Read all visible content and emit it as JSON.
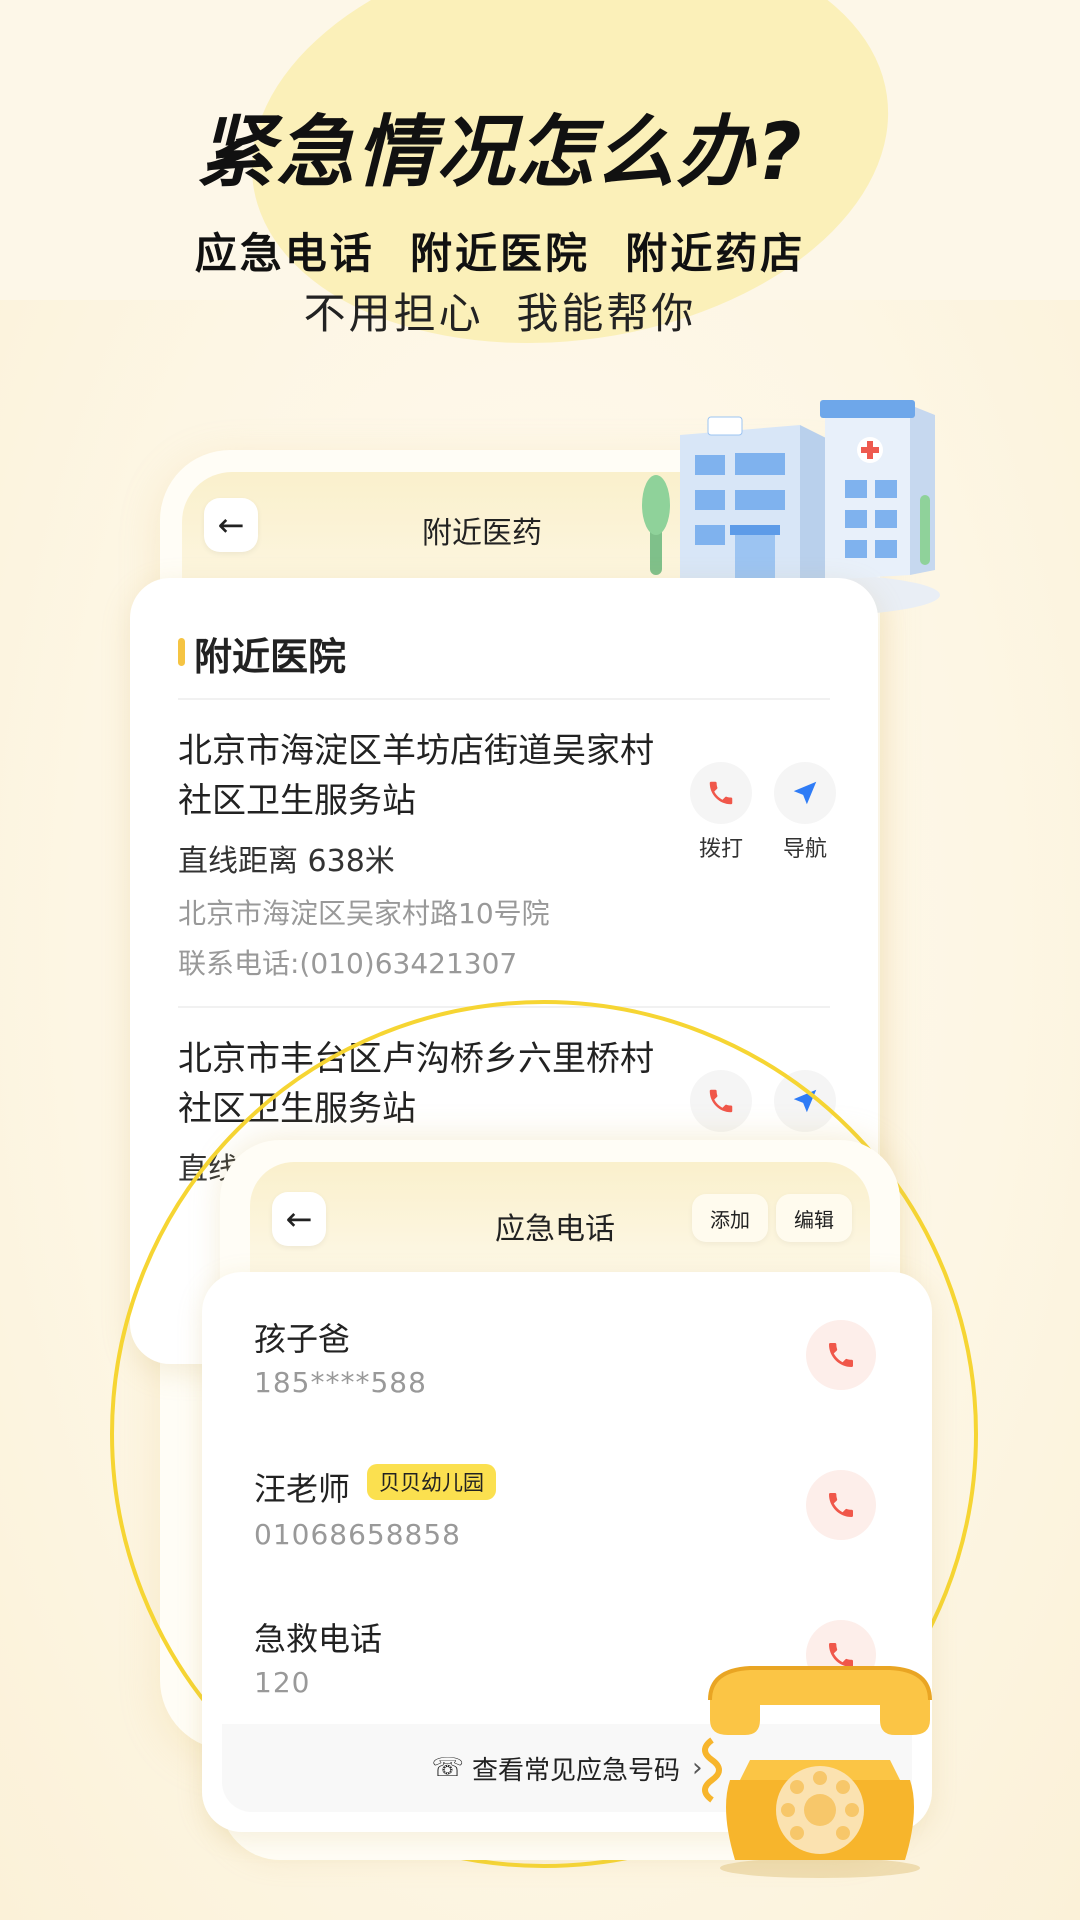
{
  "promo": {
    "headline": "紧急情况怎么办?",
    "line1": "应急电话  附近医院  附近药店",
    "line2": "不用担心  我能帮你"
  },
  "medicine_screen": {
    "title": "附近医药",
    "section_title": "附近医院",
    "hospitals": [
      {
        "name": "北京市海淀区羊坊店街道吴家村社区卫生服务站",
        "distance": "直线距离 638米",
        "address": "北京市海淀区吴家村路10号院",
        "phone": "联系电话:(010)63421307"
      },
      {
        "name": "北京市丰台区卢沟桥乡六里桥村社区卫生服务站",
        "distance": "直线距离"
      }
    ],
    "call_label": "拨打",
    "nav_label": "导航"
  },
  "emergency_screen": {
    "title": "应急电话",
    "add_label": "添加",
    "edit_label": "编辑",
    "contacts": [
      {
        "name": "孩子爸",
        "number": "185****588"
      },
      {
        "name": "汪老师",
        "tag": "贝贝幼儿园",
        "number": "01068658858"
      },
      {
        "name": "急救电话",
        "number": "120"
      }
    ],
    "footer_link": "查看常见应急号码"
  },
  "colors": {
    "accent_yellow": "#f6d533",
    "call_red": "#f0574a",
    "nav_blue": "#2f7cf6"
  }
}
